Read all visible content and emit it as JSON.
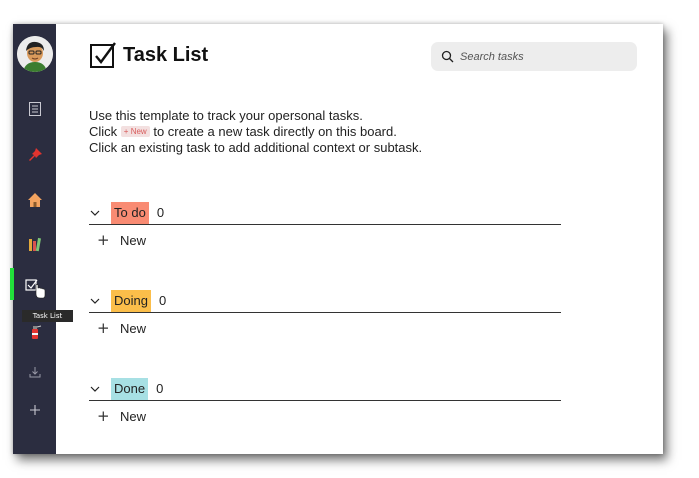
{
  "app": {
    "title": "Task List",
    "search": {
      "placeholder": "Search tasks"
    },
    "colors": {
      "sidebar": "#2b2d40",
      "active_indicator": "#22e03a"
    }
  },
  "sidebar": {
    "items": [
      {
        "name": "notes",
        "icon": "document-icon"
      },
      {
        "name": "pinned",
        "icon": "pushpin-icon"
      },
      {
        "name": "home",
        "icon": "house-icon"
      },
      {
        "name": "library",
        "icon": "books-icon"
      },
      {
        "name": "task-list",
        "icon": "checkbox-icon",
        "active": true,
        "tooltip": "Task List"
      },
      {
        "name": "fire-extinguisher",
        "icon": "fire-extinguisher-icon"
      },
      {
        "name": "download",
        "icon": "download-icon"
      },
      {
        "name": "add",
        "icon": "plus-icon"
      }
    ]
  },
  "intro": {
    "line1": "Use this template to track your opersonal tasks.",
    "line2_before": "Click",
    "new_chip": "+ New",
    "line2_after": "to create a new task directly on this board.",
    "line3": "Click an existing task to add additional context or subtask."
  },
  "groups": [
    {
      "label": "To do",
      "count": "0",
      "color": "#f98b73",
      "new_label": "New"
    },
    {
      "label": "Doing",
      "count": "0",
      "color": "#fbbe4a",
      "new_label": "New"
    },
    {
      "label": "Done",
      "count": "0",
      "color": "#a7e0e4",
      "new_label": "New"
    }
  ]
}
